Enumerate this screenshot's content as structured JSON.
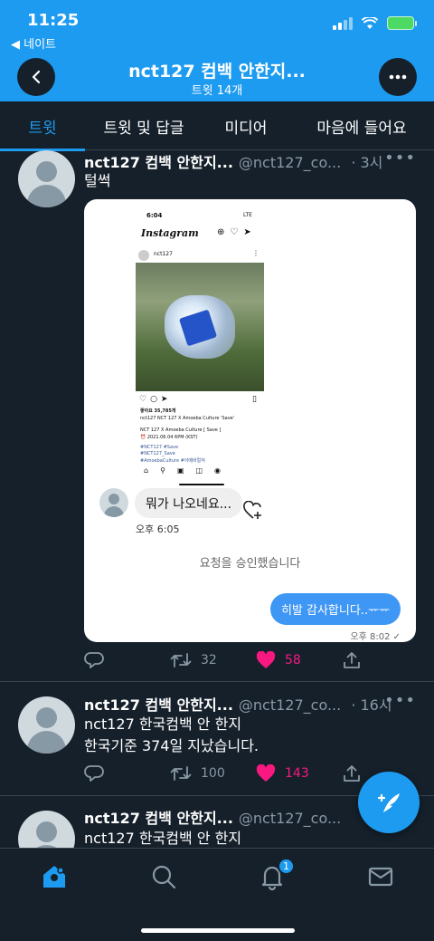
{
  "status_bar": {
    "time": "11:25",
    "back_app": "◀ 네이트"
  },
  "header": {
    "title": "nct127 컴백 안한지...",
    "subtitle": "트윗 14개"
  },
  "tabs": [
    {
      "label": "트윗"
    },
    {
      "label": "트윗 및 답글"
    },
    {
      "label": "미디어"
    },
    {
      "label": "마음에 들어요"
    }
  ],
  "tweets": [
    {
      "name": "nct127 컴백 안한지...",
      "handle": "@nct127_co...",
      "time": "· 3시",
      "text": "털썩",
      "retweets": "32",
      "likes": "58",
      "media": {
        "phone_time": "6:04",
        "phone_status": "LTE",
        "ig_logo": "Instagram",
        "ig_user": "nct127",
        "ig_likes": "좋아요 35,785개",
        "ig_caption1": "nct127 NCT 127 X Amoeba Culture 'Save'",
        "ig_caption2": "NCT 127 X Amoeba Culture [ Save ]",
        "ig_caption3": "⏰ 2021.06.04 6PM (KST)",
        "ig_tag1": "#NCT127 #Save",
        "ig_tag2": "#NCT127_Save",
        "ig_tag3": "#AmoebaCulture #아메바컬쳐",
        "dm_received": "뭐가 나오네요...",
        "dm_time": "오후 6:05",
        "dm_approved": "요청을 승인했습니다",
        "dm_sent": "히발 감사합니다..ᅲᅲ",
        "dm_sent_time": "오후 8:02 ✓"
      }
    },
    {
      "name": "nct127 컴백 안한지...",
      "handle": "@nct127_co...",
      "time": "· 16시",
      "text_line1": "nct127 한국컴백 안 한지",
      "text_line2": "한국기준 374일 지났습니다.",
      "retweets": "100",
      "likes": "143"
    },
    {
      "name": "nct127 컴백 안한지...",
      "handle": "@nct127_co...",
      "text_line1": "nct127 한국컴백 안 한지"
    }
  ],
  "bottom_nav": {
    "notification_badge": "1"
  },
  "colors": {
    "accent": "#1d9bf0",
    "background": "#15202b",
    "like": "#f91880",
    "muted": "#8899a6"
  }
}
